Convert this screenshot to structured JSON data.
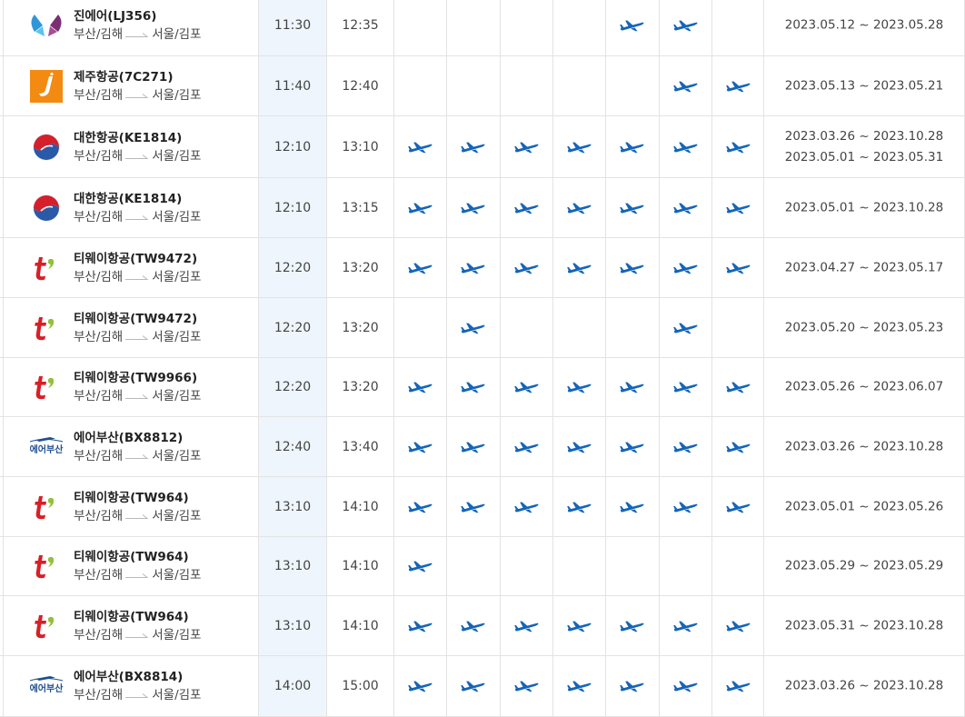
{
  "colors": {
    "plane": "#1565b8",
    "border": "#e3e3e3",
    "dep_highlight": "#eef5fd"
  },
  "route": {
    "from": "부산/김해",
    "to": "서울/김포"
  },
  "flights": [
    {
      "logo": "jinair-logo",
      "airline": "진에어(LJ356)",
      "dep": "11:30",
      "arr": "12:35",
      "days": [
        false,
        false,
        false,
        false,
        true,
        true,
        false
      ],
      "periods": [
        "2023.05.12 ~ 2023.05.28"
      ]
    },
    {
      "logo": "jejuair-logo",
      "airline": "제주항공(7C271)",
      "dep": "11:40",
      "arr": "12:40",
      "days": [
        false,
        false,
        false,
        false,
        false,
        true,
        true
      ],
      "periods": [
        "2023.05.13 ~ 2023.05.21"
      ]
    },
    {
      "logo": "koreanair-logo",
      "airline": "대한항공(KE1814)",
      "dep": "12:10",
      "arr": "13:10",
      "days": [
        true,
        true,
        true,
        true,
        true,
        true,
        true
      ],
      "periods": [
        "2023.03.26 ~ 2023.10.28",
        "2023.05.01 ~ 2023.05.31"
      ]
    },
    {
      "logo": "koreanair-logo",
      "airline": "대한항공(KE1814)",
      "dep": "12:10",
      "arr": "13:15",
      "days": [
        true,
        true,
        true,
        true,
        true,
        true,
        true
      ],
      "periods": [
        "2023.05.01 ~ 2023.10.28"
      ]
    },
    {
      "logo": "twayair-logo",
      "airline": "티웨이항공(TW9472)",
      "dep": "12:20",
      "arr": "13:20",
      "days": [
        true,
        true,
        true,
        true,
        true,
        true,
        true
      ],
      "periods": [
        "2023.04.27 ~ 2023.05.17"
      ]
    },
    {
      "logo": "twayair-logo",
      "airline": "티웨이항공(TW9472)",
      "dep": "12:20",
      "arr": "13:20",
      "days": [
        false,
        true,
        false,
        false,
        false,
        true,
        false
      ],
      "periods": [
        "2023.05.20 ~ 2023.05.23"
      ]
    },
    {
      "logo": "twayair-logo",
      "airline": "티웨이항공(TW9966)",
      "dep": "12:20",
      "arr": "13:20",
      "days": [
        true,
        true,
        true,
        true,
        true,
        true,
        true
      ],
      "periods": [
        "2023.05.26 ~ 2023.06.07"
      ]
    },
    {
      "logo": "airbusan-logo",
      "logo_text": "에어부산",
      "airline": "에어부산(BX8812)",
      "dep": "12:40",
      "arr": "13:40",
      "days": [
        true,
        true,
        true,
        true,
        true,
        true,
        true
      ],
      "periods": [
        "2023.03.26 ~ 2023.10.28"
      ]
    },
    {
      "logo": "twayair-logo",
      "airline": "티웨이항공(TW964)",
      "dep": "13:10",
      "arr": "14:10",
      "days": [
        true,
        true,
        true,
        true,
        true,
        true,
        true
      ],
      "periods": [
        "2023.05.01 ~ 2023.05.26"
      ]
    },
    {
      "logo": "twayair-logo",
      "airline": "티웨이항공(TW964)",
      "dep": "13:10",
      "arr": "14:10",
      "days": [
        true,
        false,
        false,
        false,
        false,
        false,
        false
      ],
      "periods": [
        "2023.05.29 ~ 2023.05.29"
      ]
    },
    {
      "logo": "twayair-logo",
      "airline": "티웨이항공(TW964)",
      "dep": "13:10",
      "arr": "14:10",
      "days": [
        true,
        true,
        true,
        true,
        true,
        true,
        true
      ],
      "periods": [
        "2023.05.31 ~ 2023.10.28"
      ]
    },
    {
      "logo": "airbusan-logo",
      "logo_text": "에어부산",
      "airline": "에어부산(BX8814)",
      "dep": "14:00",
      "arr": "15:00",
      "days": [
        true,
        true,
        true,
        true,
        true,
        true,
        true
      ],
      "periods": [
        "2023.03.26 ~ 2023.10.28"
      ]
    }
  ]
}
